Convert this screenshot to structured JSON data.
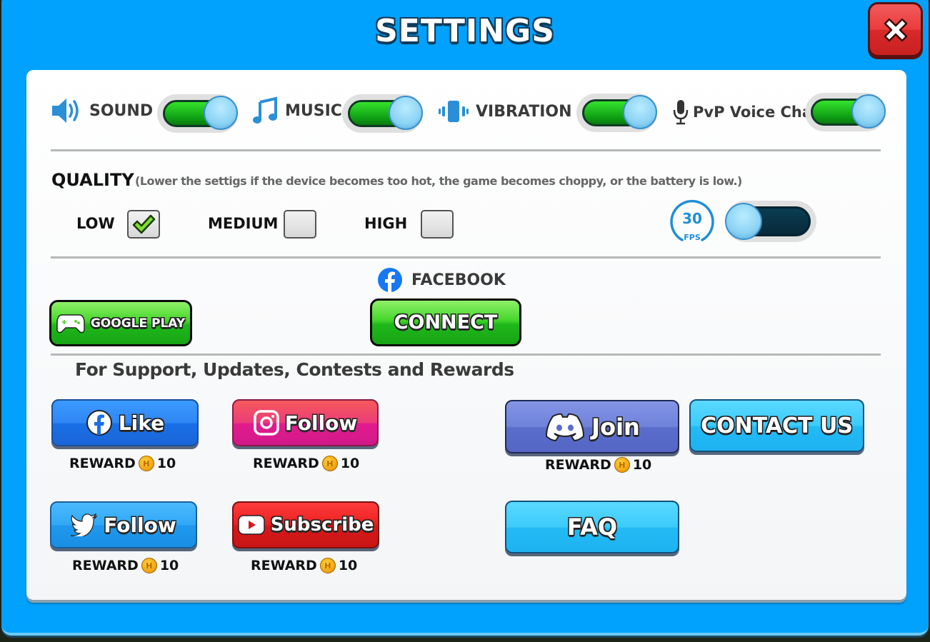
{
  "window": {
    "title": "SETTINGS",
    "close_label": "×"
  },
  "toggles": [
    {
      "label": "SOUND",
      "icon": "speaker-icon",
      "state": "on"
    },
    {
      "label": "MUSIC",
      "icon": "music-note-icon",
      "state": "on"
    },
    {
      "label": "VIBRATION",
      "icon": "vibration-icon",
      "state": "on"
    },
    {
      "label": "PvP Voice Chat",
      "icon": "microphone-icon",
      "state": "on"
    }
  ],
  "quality": {
    "title": "QUALITY",
    "hint": "(Lower the settigs if the device becomes too hot, the game becomes choppy, or the battery is low.)",
    "options": [
      {
        "label": "LOW",
        "checked": true
      },
      {
        "label": "MEDIUM",
        "checked": false
      },
      {
        "label": "HIGH",
        "checked": false
      }
    ],
    "fps": {
      "value": "30",
      "unit": "FPS",
      "toggle_state": "off"
    }
  },
  "accounts": {
    "google_play_label": "GOOGLE PLAY",
    "facebook_label": "FACEBOOK",
    "connect_label": "CONNECT"
  },
  "support": {
    "title": "For Support, Updates, Contests and Rewards",
    "reward_label": "REWARD",
    "buttons": [
      {
        "label": "Like",
        "network": "facebook",
        "icon": "facebook-icon",
        "reward": "10"
      },
      {
        "label": "Follow",
        "network": "instagram",
        "icon": "instagram-icon",
        "reward": "10"
      },
      {
        "label": "Join",
        "network": "discord",
        "icon": "discord-icon",
        "reward": "10"
      },
      {
        "label": "CONTACT US"
      },
      {
        "label": "Follow",
        "network": "twitter",
        "icon": "twitter-icon",
        "reward": "10"
      },
      {
        "label": "Subscribe",
        "network": "youtube",
        "icon": "youtube-icon",
        "reward": "10"
      },
      {
        "label": "FAQ"
      }
    ]
  },
  "colors": {
    "frame": "#00a2fd",
    "toggle_on": "#1fb81a",
    "toggle_off": "#07293a",
    "accent_green": "#45d62a",
    "close_red": "#e23a3a"
  }
}
